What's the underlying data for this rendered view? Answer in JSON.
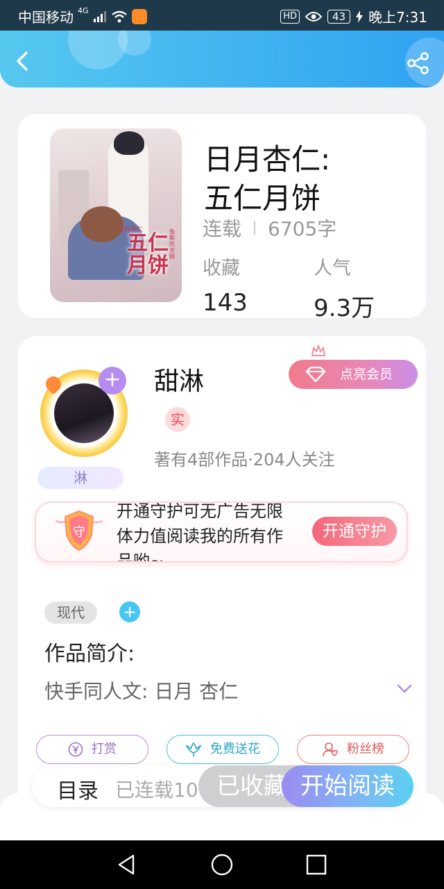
{
  "status_bar": {
    "carrier": "中国移动",
    "network": "4G",
    "hd": "HD",
    "battery": "43",
    "time": "晚上7:31"
  },
  "header": {
    "back_icon": "chevron-left-icon",
    "share_icon": "share-icon"
  },
  "book": {
    "title_line1": "日月杏仁:",
    "title_line2": "五仁月饼",
    "cover_title": "五仁月饼",
    "cover_tag": "日月杏仁",
    "cover_side": "兔斯的天网",
    "status": "连载",
    "word_count": "6705字",
    "favorites_label": "收藏",
    "favorites_value": "143",
    "popularity_label": "人气",
    "popularity_value": "9.3万"
  },
  "author": {
    "name": "甜淋",
    "avatar_name": "淋",
    "verified_badge": "实",
    "meta": "著有4部作品·204人关注",
    "vip_button": "点亮会员"
  },
  "guard": {
    "shield_text": "守",
    "text": "开通守护可无广告无限体力值阅读我的所有作品哟~",
    "button": "开通守护"
  },
  "tags": {
    "genre": "现代"
  },
  "intro": {
    "title": "作品简介:",
    "text": "快手同人文:  日月 杏仁"
  },
  "actions": {
    "reward": "打赏",
    "flower": "免费送花",
    "fans": "粉丝榜"
  },
  "bottom_bar": {
    "toc": "目录",
    "toc_sub": "已连载10",
    "collected": "已收藏",
    "read": "开始阅读"
  },
  "colors": {
    "header_start": "#56c8ef",
    "header_end": "#2fa2f2",
    "guard_button": "#f4667a",
    "read_button_start": "#9b8cf0",
    "read_button_end": "#5ad0f0"
  }
}
